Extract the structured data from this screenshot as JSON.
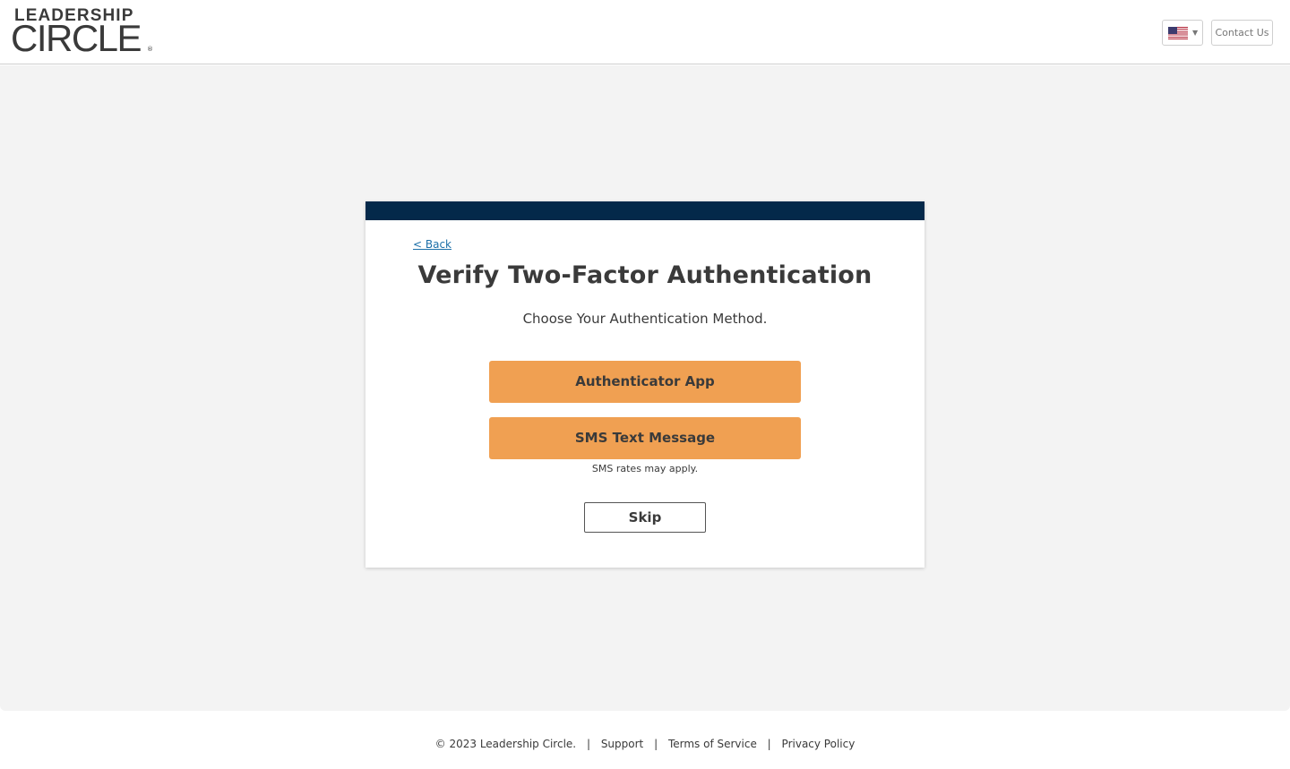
{
  "header": {
    "logo_top": "LEADERSHIP",
    "logo_bottom": "CIRCLE",
    "logo_reg": "®",
    "language_flag": "us-flag-icon",
    "language_caret": "▼",
    "contact_label": "Contact Us"
  },
  "card": {
    "bar_color": "#04294a",
    "back_label": "< Back",
    "title": "Verify Two-Factor Authentication",
    "subtitle": "Choose Your Authentication Method.",
    "authenticator_label": "Authenticator App",
    "sms_label": "SMS Text Message",
    "sms_note": "SMS rates may apply.",
    "skip_label": "Skip",
    "button_color": "#f0a052"
  },
  "footer": {
    "copyright": "© 2023 Leadership Circle.",
    "separator": "|",
    "links": [
      "Support",
      "Terms of Service",
      "Privacy Policy"
    ]
  }
}
